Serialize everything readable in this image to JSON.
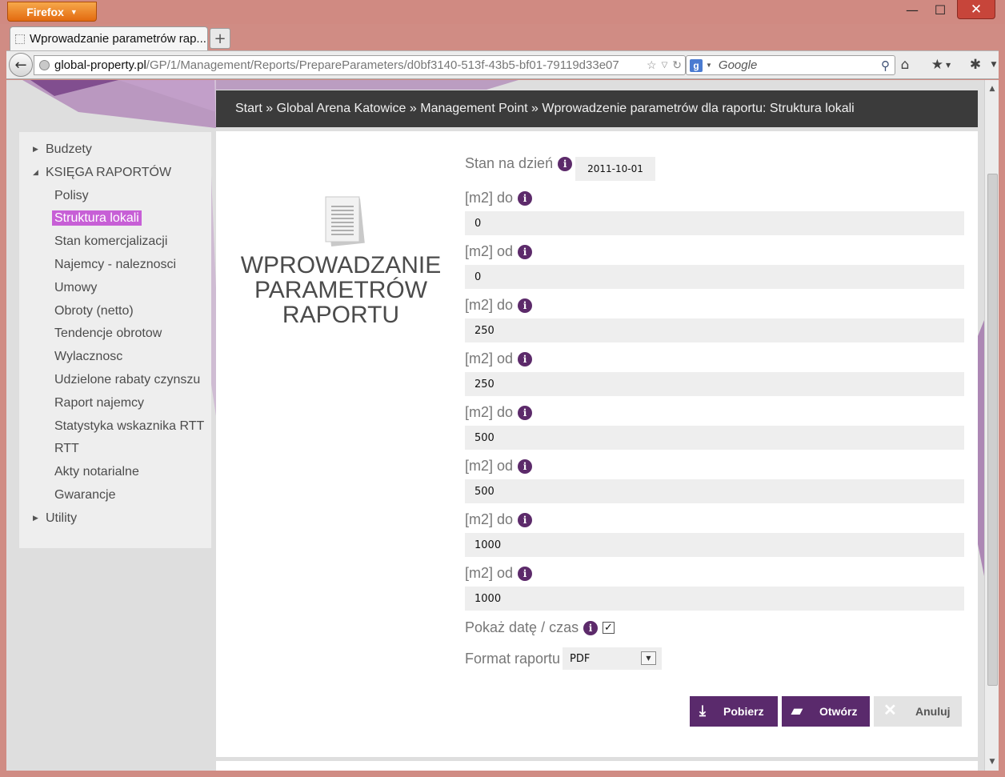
{
  "browser": {
    "app_button": "Firefox",
    "tab_title": "Wprowadzanie parametrów rap...",
    "new_tab": "+",
    "url_host": "global-property.pl",
    "url_path": "/GP/1/Management/Reports/PrepareParameters/d0bf3140-513f-43b5-bf01-79119d33e07",
    "search_engine": "g",
    "search_placeholder": "Google",
    "minimize": "—",
    "maximize": "☐",
    "close": "✕"
  },
  "breadcrumb": "Start » Global Arena Katowice » Management Point » Wprowadzenie parametrów dla raportu: Struktura lokali",
  "sidebar": {
    "items": [
      {
        "label": "Budzety",
        "level": 0,
        "expander": "collapsed"
      },
      {
        "label": "KSIĘGA RAPORTÓW",
        "level": 0,
        "expander": "expanded"
      },
      {
        "label": "Polisy",
        "level": 1
      },
      {
        "label": "Struktura lokali",
        "level": 1,
        "active": true
      },
      {
        "label": "Stan komercjalizacji",
        "level": 1
      },
      {
        "label": "Najemcy - naleznosci",
        "level": 1
      },
      {
        "label": "Umowy",
        "level": 1
      },
      {
        "label": "Obroty (netto)",
        "level": 1
      },
      {
        "label": "Tendencje obrotow",
        "level": 1
      },
      {
        "label": "Wylacznosc",
        "level": 1
      },
      {
        "label": "Udzielone rabaty czynszu",
        "level": 1
      },
      {
        "label": "Raport najemcy",
        "level": 1
      },
      {
        "label": "Statystyka wskaznika RTT",
        "level": 1
      },
      {
        "label": "RTT",
        "level": 1
      },
      {
        "label": "Akty notarialne",
        "level": 1
      },
      {
        "label": "Gwarancje",
        "level": 1
      },
      {
        "label": "Utility",
        "level": 0,
        "expander": "collapsed"
      }
    ]
  },
  "main": {
    "title": "WPROWADZANIE PARAMETRÓW RAPORTU",
    "stan_label": "Stan na dzień",
    "stan_value": "2011-10-01",
    "params": [
      {
        "label": "[m2] do",
        "value": "0"
      },
      {
        "label": "[m2] od",
        "value": "0"
      },
      {
        "label": "[m2] do",
        "value": "250"
      },
      {
        "label": "[m2] od",
        "value": "250"
      },
      {
        "label": "[m2] do",
        "value": "500"
      },
      {
        "label": "[m2] od",
        "value": "500"
      },
      {
        "label": "[m2] do",
        "value": "1000"
      },
      {
        "label": "[m2] od",
        "value": "1000"
      }
    ],
    "show_date_label": "Pokaż datę / czas",
    "show_date_checked": true,
    "format_label": "Format raportu",
    "format_value": "PDF",
    "buttons": {
      "download": "Pobierz",
      "open": "Otwórz",
      "cancel": "Anuluj"
    }
  },
  "colors": {
    "accent": "#5a2a6c",
    "active_item": "#c75fd6",
    "breadcrumb_bg": "#3b3b3b",
    "window_frame": "#d08c84"
  }
}
